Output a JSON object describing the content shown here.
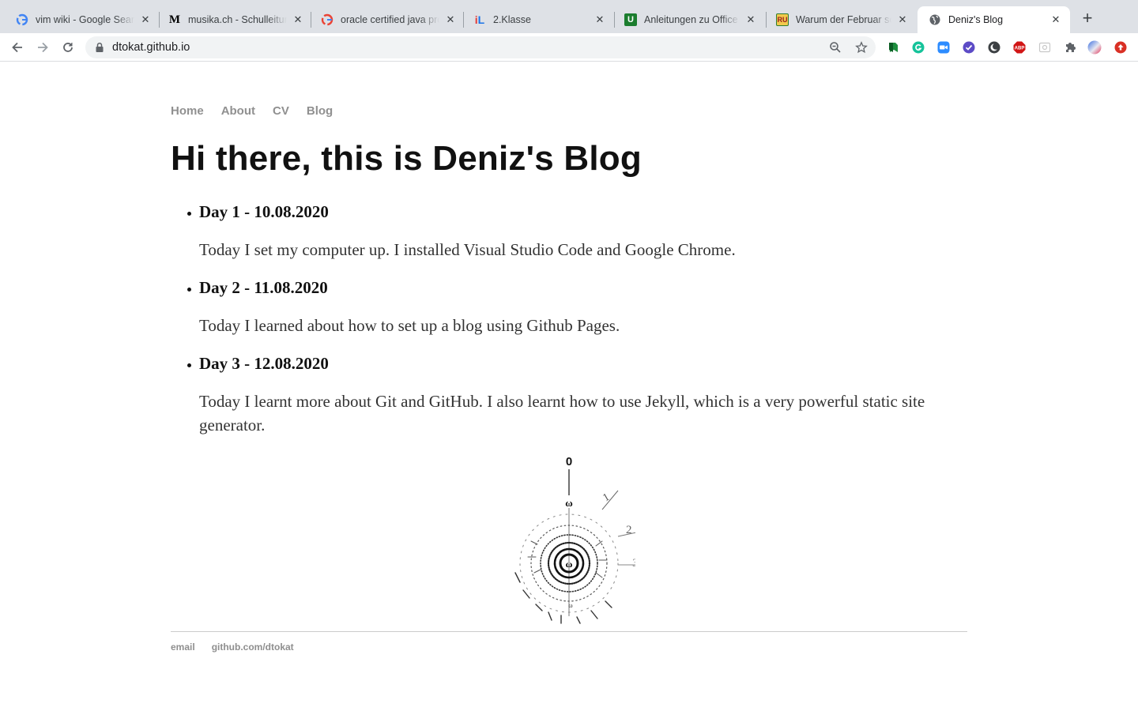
{
  "browser": {
    "tabs": [
      {
        "title": "vim wiki - Google Search",
        "favicon": "google-icon"
      },
      {
        "title": "musika.ch - Schulleitung",
        "favicon": "musika-icon"
      },
      {
        "title": "oracle certified java programmer",
        "favicon": "google-icon"
      },
      {
        "title": "2.Klasse",
        "favicon": "il-icon"
      },
      {
        "title": "Anleitungen zu Office",
        "favicon": "u-icon"
      },
      {
        "title": "Warum der Februar so kurz ist",
        "favicon": "ru-icon"
      },
      {
        "title": "Deniz's Blog",
        "favicon": "globe-icon"
      }
    ],
    "url": "dtokat.github.io",
    "colors": {
      "tabstrip": "#dee1e6",
      "active_tab": "#ffffff",
      "omnibox": "#f1f3f4"
    }
  },
  "site": {
    "nav": [
      "Home",
      "About",
      "CV",
      "Blog"
    ],
    "title": "Hi there, this is Deniz's Blog",
    "posts": [
      {
        "heading": "Day 1 - 10.08.2020",
        "body": "Today I set my computer up. I installed Visual Studio Code and Google Chrome."
      },
      {
        "heading": "Day 2 - 11.08.2020",
        "body": "Today I learned about how to set up a blog using Github Pages."
      },
      {
        "heading": "Day 3 - 12.08.2020",
        "body": "Today I learnt more about Git and GitHub. I also learnt how to use Jekyll, which is a very powerful static site generator."
      }
    ],
    "logo": {
      "top_label": "0",
      "labels": [
        "1",
        "2",
        "3",
        "ω"
      ]
    },
    "footer": [
      "email",
      "github.com/dtokat"
    ]
  }
}
